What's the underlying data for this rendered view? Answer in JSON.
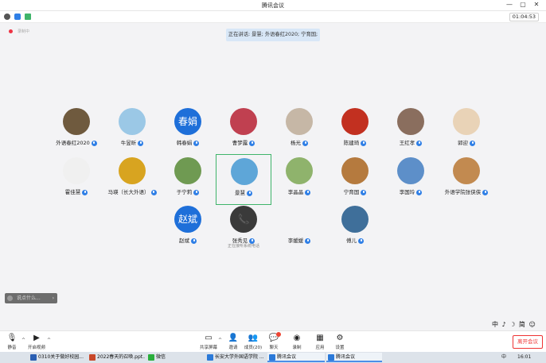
{
  "window": {
    "title": "腾讯会议",
    "controls": [
      "—",
      "▢",
      "✕"
    ]
  },
  "topbar": {
    "timer": "01:04:53",
    "rec_text": "录制中"
  },
  "speaking": "正在讲话: 景慧; 外语春红2020; 宁育国;",
  "participants": [
    {
      "name": "外语春红2020",
      "avatar_color": "#6f5a3e",
      "avatar_text": ""
    },
    {
      "name": "牛昱昕",
      "avatar_color": "#9bc8e6",
      "avatar_text": ""
    },
    {
      "name": "韩春娟",
      "avatar_color": "#1e6fd9",
      "avatar_text": "春娟"
    },
    {
      "name": "曹梦露",
      "avatar_color": "#c04050",
      "avatar_text": ""
    },
    {
      "name": "杨光",
      "avatar_color": "#c6b7a6",
      "avatar_text": ""
    },
    {
      "name": "陈建琦",
      "avatar_color": "#c23020",
      "avatar_text": ""
    },
    {
      "name": "王红孝",
      "avatar_color": "#8a6e5e",
      "avatar_text": ""
    },
    {
      "name": "郭迎",
      "avatar_color": "#e9d3b7",
      "avatar_text": ""
    },
    {
      "name": "霍佳慧",
      "avatar_color": "#f0f0f0",
      "avatar_text": ""
    },
    {
      "name": "马瑛（长大外语）",
      "avatar_color": "#d8a420",
      "avatar_text": ""
    },
    {
      "name": "于宁莉",
      "avatar_color": "#6f9a52",
      "avatar_text": ""
    },
    {
      "name": "景慧",
      "avatar_color": "#5ea6d8",
      "avatar_text": ""
    },
    {
      "name": "李晶晶",
      "avatar_color": "#8fb36c",
      "avatar_text": ""
    },
    {
      "name": "宁育国",
      "avatar_color": "#b57a3e",
      "avatar_text": ""
    },
    {
      "name": "李国玲",
      "avatar_color": "#5d8fc9",
      "avatar_text": ""
    },
    {
      "name": "外语学院张侠侠",
      "avatar_color": "#c28a50",
      "avatar_text": ""
    },
    {
      "name": "赵斌",
      "avatar_color": "#1e6fd9",
      "avatar_text": "赵斌"
    },
    {
      "name": "张秀见",
      "avatar_color": "#3a3a3a",
      "avatar_text": "📞",
      "sub": "正在接听系统电话"
    },
    {
      "name": "李媛媛",
      "avatar_color": "#f3f3f5",
      "avatar_text": ""
    },
    {
      "name": "傅儿",
      "avatar_color": "#3f6f9a",
      "avatar_text": ""
    }
  ],
  "chat": {
    "placeholder": "说点什么...",
    "arrow": "›"
  },
  "ime": "中 ♪ ☽ 简 ☺",
  "toolbar": {
    "mute": "静音",
    "video": "开启视频",
    "share": "共享屏幕",
    "invite": "邀请",
    "members": "成员(20)",
    "chat": "聊天",
    "record": "录制",
    "apps": "应用",
    "settings": "设置",
    "leave": "离开会议",
    "caret": "^"
  },
  "taskbar": {
    "items": [
      {
        "label": "0310关于做好校园...",
        "color": "#2b5fb3"
      },
      {
        "label": "2022春天的召唤.ppt...",
        "color": "#c8482a"
      },
      {
        "label": "微信",
        "color": "#2aae3c"
      },
      {
        "label": "长安大学外国语学院 ...",
        "color": "#2b7ad9"
      },
      {
        "label": "腾讯会议",
        "color": "#2b7ad9"
      },
      {
        "label": "腾讯会议",
        "color": "#2b7ad9"
      }
    ],
    "lang": "中",
    "clock": "16:01"
  }
}
